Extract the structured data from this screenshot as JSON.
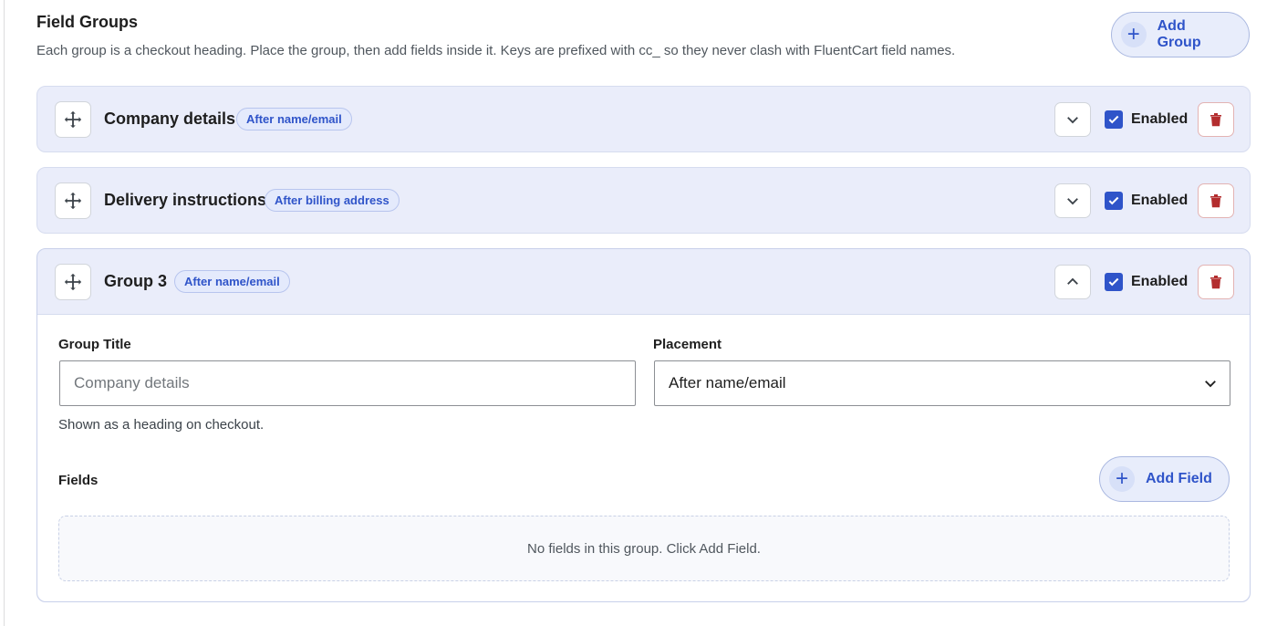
{
  "header": {
    "title": "Field Groups",
    "description": "Each group is a checkout heading. Place the group, then add fields inside it. Keys are prefixed with cc_ so they never clash with FluentCart field names.",
    "add_group_label": "Add Group"
  },
  "groups": [
    {
      "name": "Company details",
      "placement_badge": "After name/email",
      "enabled_label": "Enabled",
      "enabled": true,
      "expanded": false
    },
    {
      "name": "Delivery instructions",
      "placement_badge": "After billing address",
      "enabled_label": "Enabled",
      "enabled": true,
      "expanded": false
    },
    {
      "name": "Group 3",
      "placement_badge": "After name/email",
      "enabled_label": "Enabled",
      "enabled": true,
      "expanded": true
    }
  ],
  "editor": {
    "group_title_label": "Group Title",
    "group_title_placeholder": "Company details",
    "group_title_value": "",
    "group_title_help": "Shown as a heading on checkout.",
    "placement_label": "Placement",
    "placement_value": "After name/email",
    "fields_label": "Fields",
    "add_field_label": "Add Field",
    "empty_message": "No fields in this group. Click Add Field."
  },
  "icons": {
    "add": "plus-icon",
    "drag": "move-arrows-icon",
    "collapse": "chevron-icon",
    "check": "checkmark-icon",
    "delete": "trash-icon",
    "dropdown": "chevron-down-icon"
  },
  "colors": {
    "accent": "#2f54c9",
    "card_header_bg": "#eaedfa",
    "danger": "#b32d2e"
  }
}
